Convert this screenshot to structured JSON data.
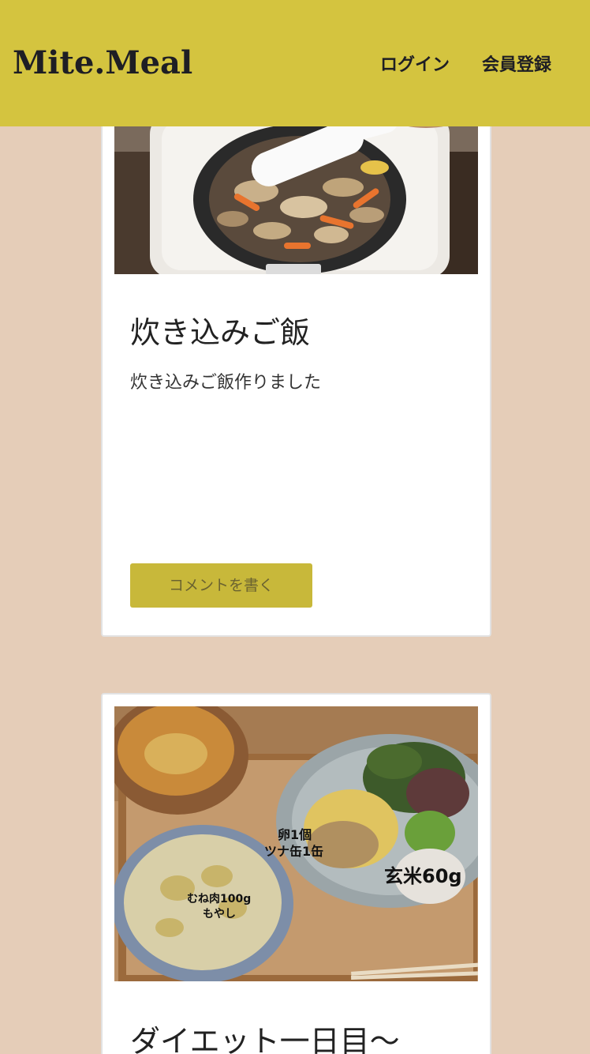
{
  "header": {
    "logo": "Mite.Meal",
    "login": "ログイン",
    "register": "会員登録"
  },
  "posts": [
    {
      "title": "炊き込みご飯",
      "body": "炊き込みご飯作りました",
      "comment_label": "コメントを書く"
    },
    {
      "title": "ダイエット一日目〜",
      "photo_labels": {
        "egg": "卵1個",
        "tuna": "ツナ缶1缶",
        "rice": "玄米60g",
        "chicken": "むね肉100g",
        "sprouts": "もやし"
      }
    }
  ],
  "colors": {
    "header": "#d4c43f",
    "background": "#e5cdb8",
    "button": "#c8b83a"
  }
}
